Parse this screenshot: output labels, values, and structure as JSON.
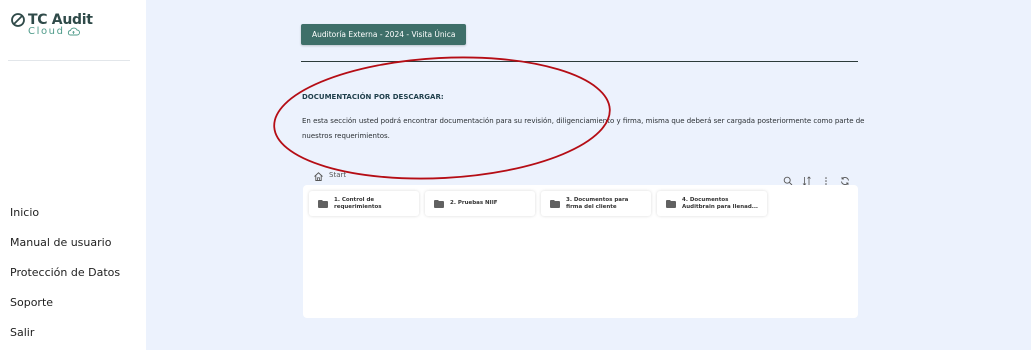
{
  "app": {
    "logo_title": "TC Audit",
    "logo_sub": "Cloud"
  },
  "sidebar": {
    "items": [
      {
        "label": "Inicio"
      },
      {
        "label": "Manual de usuario"
      },
      {
        "label": "Protección de Datos"
      },
      {
        "label": "Soporte"
      },
      {
        "label": "Salir"
      }
    ]
  },
  "main": {
    "tab_label": "Auditoría Externa - 2024 - Visita Única",
    "section_title": "DOCUMENTACIÓN POR DESCARGAR:",
    "section_desc": "En esta sección usted podrá encontrar documentación para su revisión, diligenciamiento y firma, misma que deberá ser cargada posteriormente como parte de nuestros requerimientos."
  },
  "file_manager": {
    "breadcrumb": "Start",
    "folders": [
      {
        "label_line1": "1. Control de",
        "label_line2": "requerimientos"
      },
      {
        "label_line1": "2. Pruebas NIIF",
        "label_line2": ""
      },
      {
        "label_line1": "3. Documentos para",
        "label_line2": "firma del cliente"
      },
      {
        "label_line1": "4. Documentos",
        "label_line2": "Auditbrain para llenad..."
      }
    ]
  },
  "colors": {
    "accent": "#3e6f69",
    "background": "#ecf2fd",
    "annotation": "#b50d15"
  },
  "icons": [
    "home-icon",
    "search-icon",
    "sort-icon",
    "more-vertical-icon",
    "refresh-icon",
    "folder-icon",
    "cloud-icon",
    "logo-icon"
  ]
}
